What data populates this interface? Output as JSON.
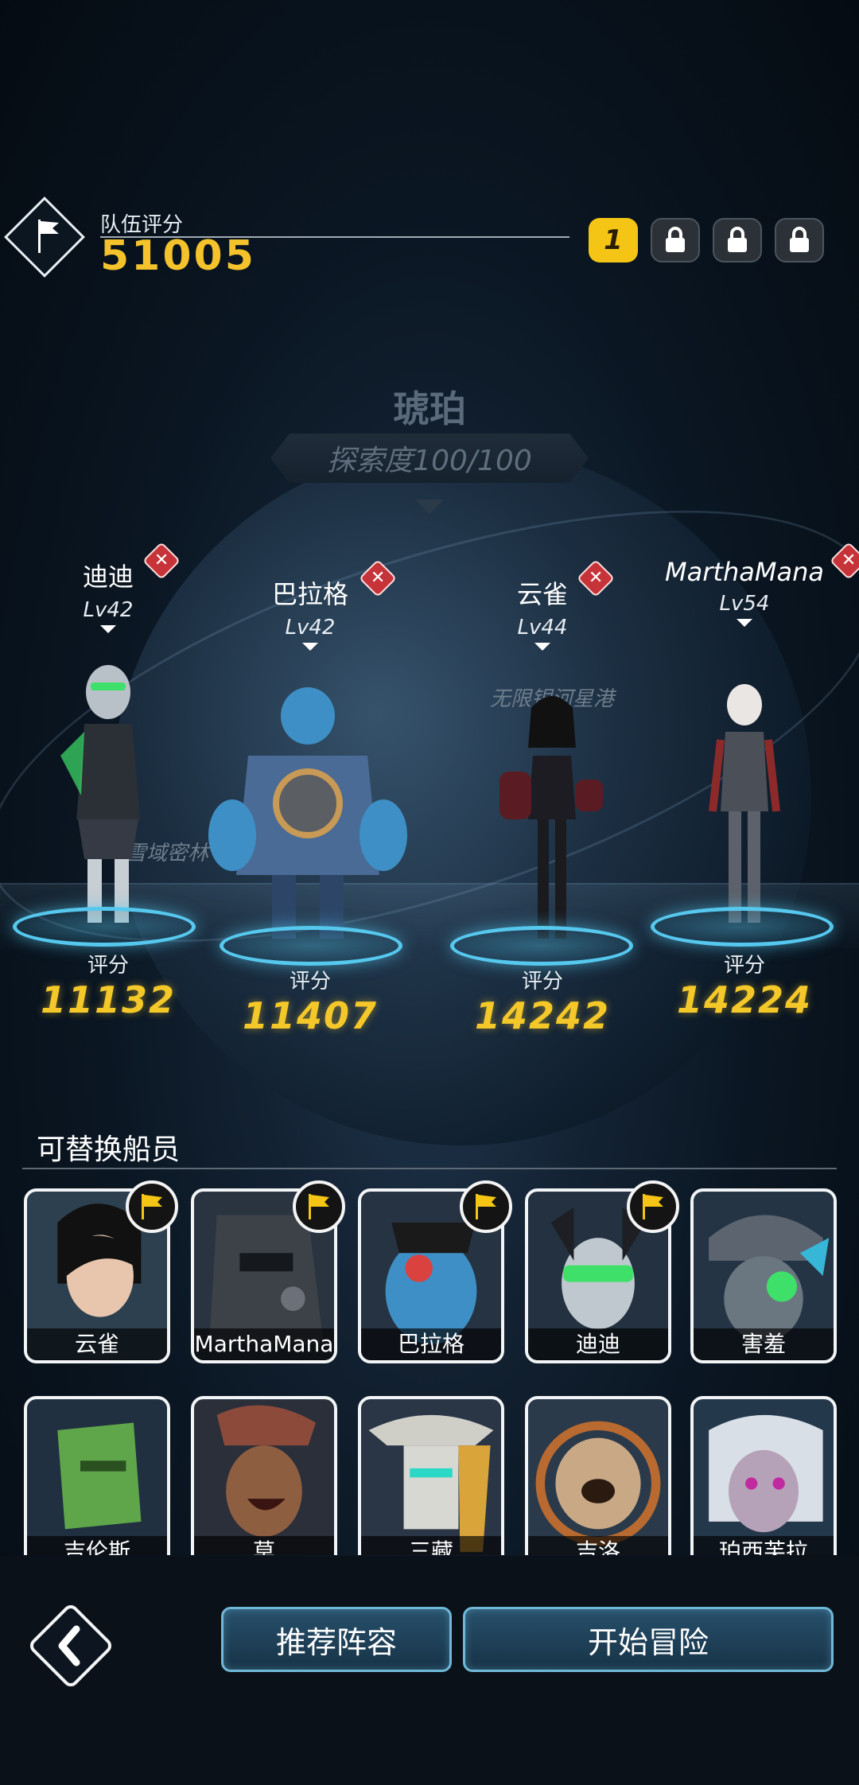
{
  "team": {
    "label": "队伍评分",
    "score": "51005",
    "active_slot": "1"
  },
  "location": {
    "name": "琥珀",
    "exploration": "探索度100/100",
    "labels": [
      "无限银河星港",
      "雪域密林"
    ]
  },
  "crew": [
    {
      "name": "迪迪",
      "level": "Lv42",
      "score_label": "评分",
      "score": "11132"
    },
    {
      "name": "巴拉格",
      "level": "Lv42",
      "score_label": "评分",
      "score": "11407"
    },
    {
      "name": "云雀",
      "level": "Lv44",
      "score_label": "评分",
      "score": "14242"
    },
    {
      "name": "MarthaMana",
      "level": "Lv54",
      "score_label": "评分",
      "score": "14224"
    }
  ],
  "replaceable": {
    "title": "可替换船员",
    "row1": [
      {
        "name": "云雀",
        "leader": true
      },
      {
        "name": "MarthaMana",
        "leader": true
      },
      {
        "name": "巴拉格",
        "leader": true
      },
      {
        "name": "迪迪",
        "leader": true
      },
      {
        "name": "害羞",
        "leader": false
      }
    ],
    "row2": [
      {
        "name": "吉伦斯"
      },
      {
        "name": "莫"
      },
      {
        "name": "三藏"
      },
      {
        "name": "吉洛"
      },
      {
        "name": "珀西芙拉"
      }
    ]
  },
  "buttons": {
    "recommend": "推荐阵容",
    "start": "开始冒险"
  },
  "colors": {
    "accent_gold": "#f5c82a",
    "pad_blue": "#56c8ee",
    "remove_red": "#c6343a",
    "button_border": "#6fb8d8"
  },
  "icons": {
    "team": "flag-icon",
    "slot_locked": "lock-icon",
    "remove": "close-icon",
    "leader": "flag-icon",
    "back": "chevron-left-icon"
  }
}
